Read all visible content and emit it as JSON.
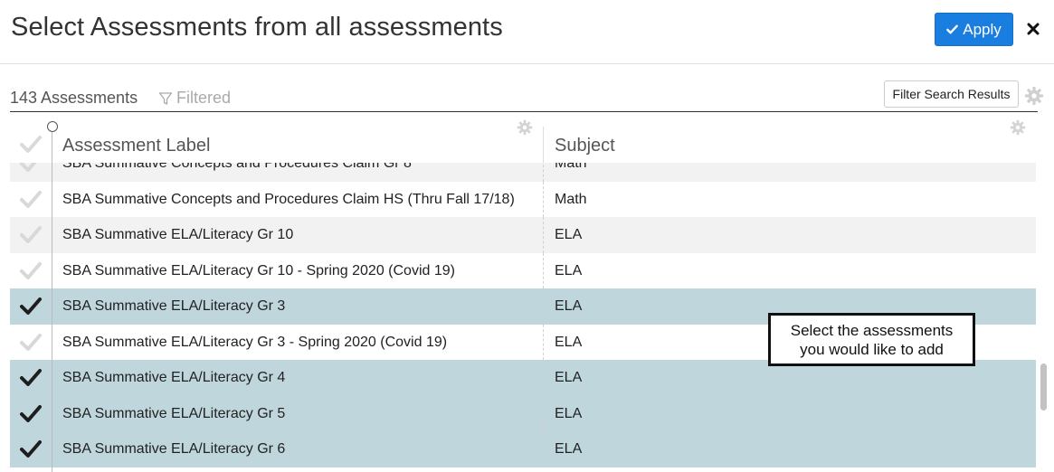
{
  "header": {
    "title": "Select Assessments from all assessments",
    "apply_label": "Apply",
    "accent_color": "#1a7de0"
  },
  "toolbar": {
    "count": "143 Assessments",
    "filtered": "Filtered",
    "filter_button": "Filter Search Results"
  },
  "columns": {
    "label": "Assessment Label",
    "subject": "Subject"
  },
  "rows": [
    {
      "label": "SBA Summative Concepts and Procedures Claim Gr 8",
      "subject": "Math",
      "selected": false
    },
    {
      "label": "SBA Summative Concepts and Procedures Claim HS (Thru Fall 17/18)",
      "subject": "Math",
      "selected": false
    },
    {
      "label": "SBA Summative ELA/Literacy Gr 10",
      "subject": "ELA",
      "selected": false
    },
    {
      "label": "SBA Summative ELA/Literacy Gr 10 - Spring 2020 (Covid 19)",
      "subject": "ELA",
      "selected": false
    },
    {
      "label": "SBA Summative ELA/Literacy Gr 3",
      "subject": "ELA",
      "selected": true
    },
    {
      "label": "SBA Summative ELA/Literacy Gr 3 - Spring 2020 (Covid 19)",
      "subject": "ELA",
      "selected": false
    },
    {
      "label": "SBA Summative ELA/Literacy Gr 4",
      "subject": "ELA",
      "selected": true
    },
    {
      "label": "SBA Summative ELA/Literacy Gr 5",
      "subject": "ELA",
      "selected": true
    },
    {
      "label": "SBA Summative ELA/Literacy Gr 6",
      "subject": "ELA",
      "selected": true
    }
  ],
  "callout": {
    "line1": "Select the assessments",
    "line2": "you would like to add"
  },
  "icons": {
    "apply": "check-icon",
    "close": "close-icon",
    "filter": "funnel-icon",
    "settings": "gear-icon",
    "row_check": "check-icon"
  },
  "colors": {
    "selected_row": "#bfd7dc",
    "check_on": "#1e1e1e",
    "check_off": "#d8d8d8"
  }
}
